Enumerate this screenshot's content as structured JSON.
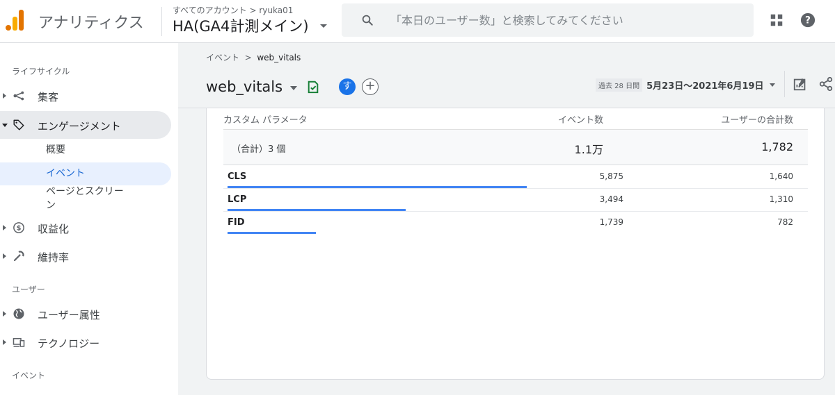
{
  "header": {
    "app_title": "アナリティクス",
    "account_path": "すべてのアカウント > ryuka01",
    "property_name": "HA(GA4計測メイン)",
    "search_placeholder": "「本日のユーザー数」と検索してみてください"
  },
  "sidebar": {
    "sections": [
      {
        "label": "ライフサイクル"
      },
      {
        "label": "ユーザー"
      },
      {
        "label": "イベント"
      }
    ],
    "items": [
      {
        "label": "集客",
        "icon": "acquisition-icon"
      },
      {
        "label": "エンゲージメント",
        "icon": "tag-icon",
        "expanded": true
      },
      {
        "label": "収益化",
        "icon": "dollar-icon"
      },
      {
        "label": "維持率",
        "icon": "retention-icon"
      },
      {
        "label": "ユーザー属性",
        "icon": "globe-icon"
      },
      {
        "label": "テクノロジー",
        "icon": "devices-icon"
      }
    ],
    "sub_items": [
      {
        "label": "概要"
      },
      {
        "label": "イベント",
        "active": true
      },
      {
        "label": "ページとスクリーン"
      }
    ]
  },
  "main": {
    "breadcrumb": {
      "parent": "イベント",
      "current": "web_vitals"
    },
    "title": "web_vitals",
    "avatar_initial": "す",
    "add_label": "+",
    "date_label": "過去 28 日間",
    "date_range": "5月23日～2021年6月19日"
  },
  "table": {
    "headers": [
      "カスタム パラメータ",
      "イベント数",
      "ユーザーの合計数"
    ],
    "total": {
      "label": "（合計）3 個",
      "events": "1.1万",
      "users": "1,782"
    },
    "rows": [
      {
        "name": "CLS",
        "events": "5,875",
        "users": "1,640",
        "events_value": 5875
      },
      {
        "name": "LCP",
        "events": "3,494",
        "users": "1,310",
        "events_value": 3494
      },
      {
        "name": "FID",
        "events": "1,739",
        "users": "782",
        "events_value": 1739
      }
    ]
  },
  "colors": {
    "accent": "#1a73e8",
    "bar": "#4285f4",
    "check": "#188038"
  }
}
